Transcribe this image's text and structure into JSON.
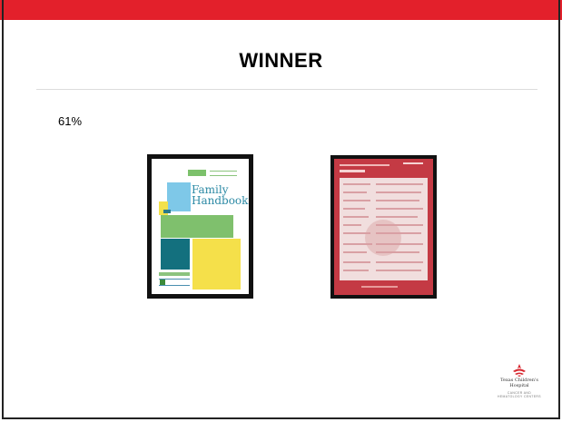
{
  "slide": {
    "title": "WINNER",
    "percentage": "61%",
    "images": [
      {
        "name": "family-handbook",
        "title": "Family Handbook"
      },
      {
        "name": "red-document"
      }
    ],
    "logo": {
      "name": "Texas Children's Hospital",
      "subtitle_line1": "CANCER AND",
      "subtitle_line2": "HEMATOLOGY CENTERS"
    }
  },
  "colors": {
    "top_bar": "#e3202b",
    "handbook_green": "#7fc06d",
    "handbook_blue": "#7ec8e8",
    "handbook_teal": "#13707e",
    "handbook_yellow": "#f5e04a",
    "document_red": "#c43a44"
  }
}
